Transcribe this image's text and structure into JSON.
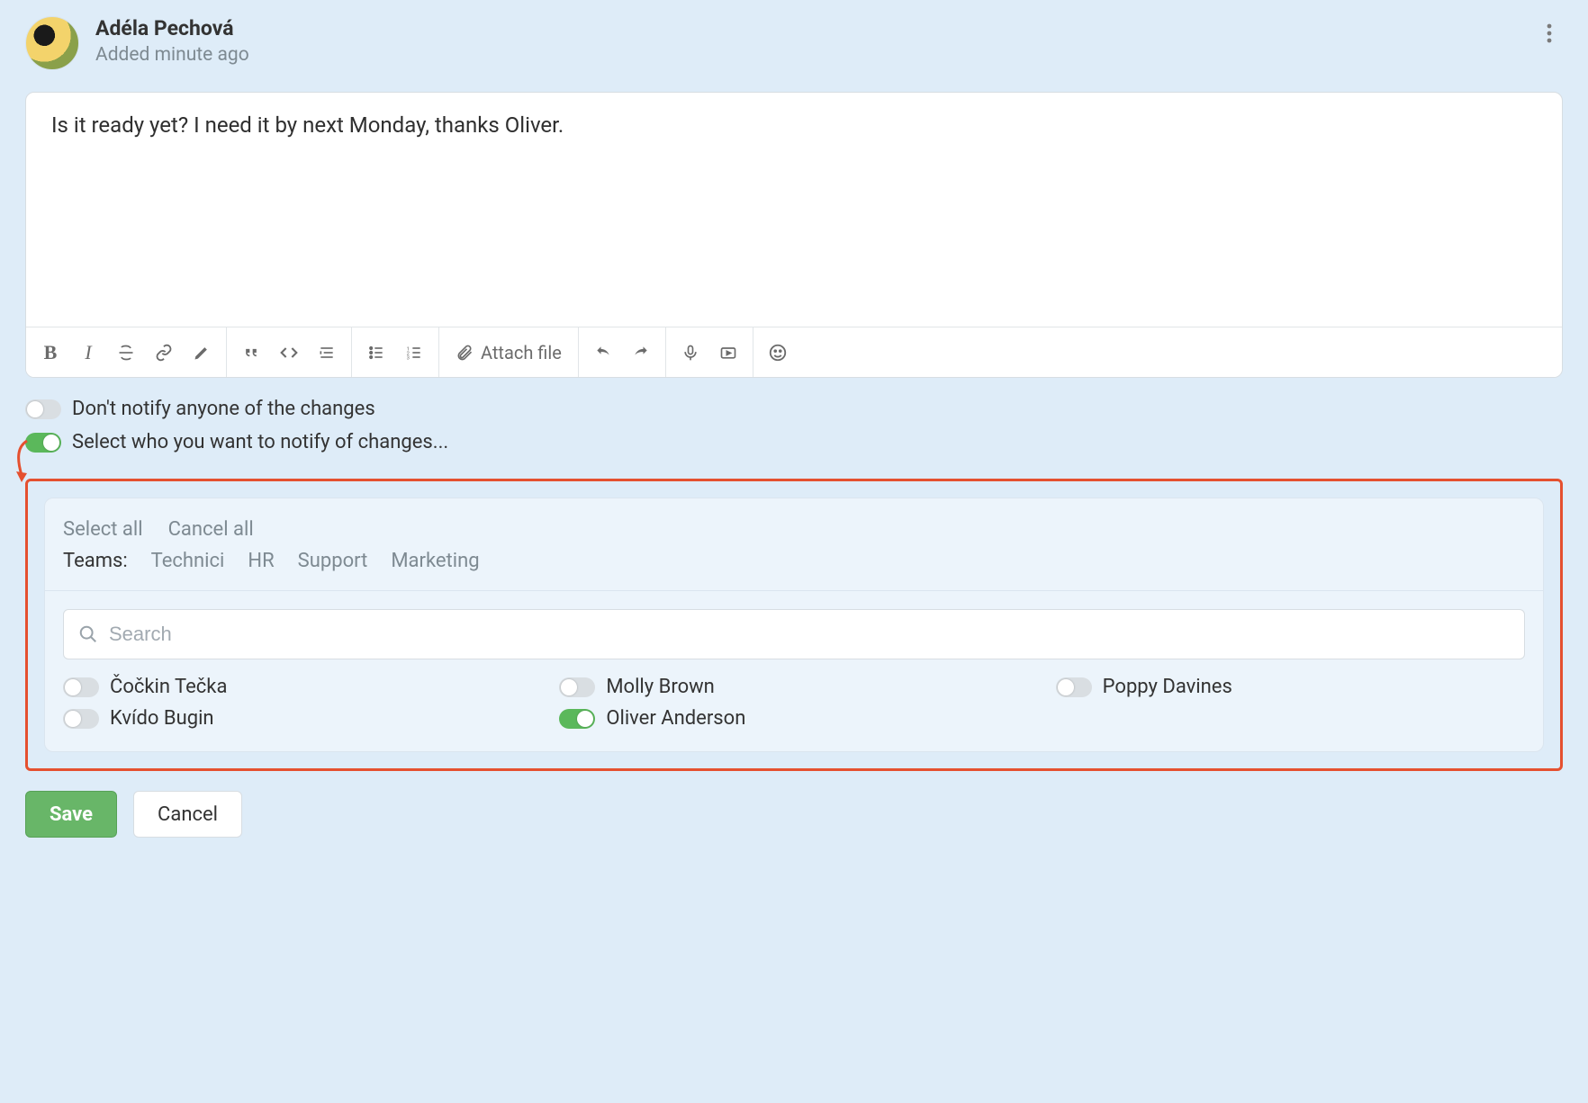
{
  "header": {
    "user_name": "Adéla Pechová",
    "added_time": "Added minute ago"
  },
  "editor": {
    "body": "Is it ready yet? I need it by next Monday, thanks Oliver.",
    "attach_label": "Attach file"
  },
  "toggles": {
    "dont_notify": {
      "label": "Don't notify anyone of the changes",
      "on": false
    },
    "select_notify": {
      "label": "Select who you want to notify of changes...",
      "on": true
    }
  },
  "panel": {
    "select_all": "Select all",
    "cancel_all": "Cancel all",
    "teams_label": "Teams:",
    "teams": [
      "Technici",
      "HR",
      "Support",
      "Marketing"
    ],
    "search_placeholder": "Search",
    "people": [
      {
        "name": "Čočkin Tečka",
        "on": false
      },
      {
        "name": "Molly Brown",
        "on": false
      },
      {
        "name": "Poppy Davines",
        "on": false
      },
      {
        "name": "Kvído Bugin",
        "on": false
      },
      {
        "name": "Oliver Anderson",
        "on": true
      }
    ]
  },
  "actions": {
    "save": "Save",
    "cancel": "Cancel"
  }
}
